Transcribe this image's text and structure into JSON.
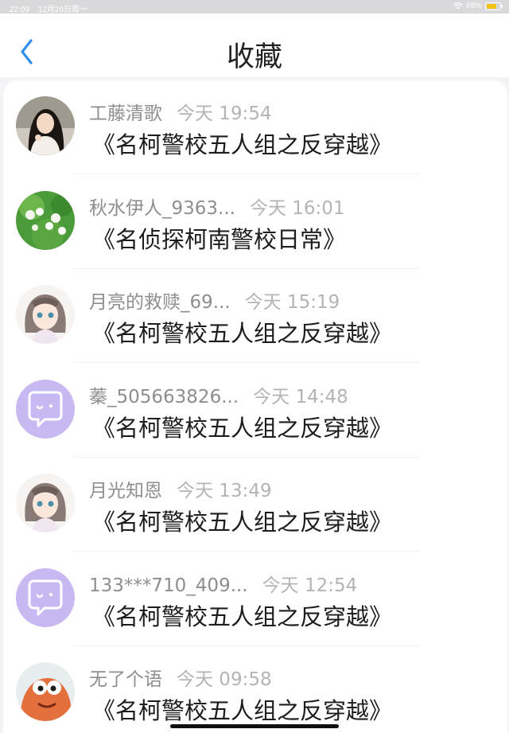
{
  "status_bar": {
    "time": "22:09",
    "date": "12月26日周一",
    "battery": "69%",
    "battery_level": 0.69
  },
  "header": {
    "title": "收藏",
    "back_icon": "chevron-left-icon"
  },
  "colors": {
    "accent": "#2f8ff0",
    "avatar_placeholder": "#c9b9f2"
  },
  "items": [
    {
      "user": "工藤清歌",
      "time": "今天 19:54",
      "title": "《名柯警校五人组之反穿越》",
      "avatar": "photo-girl-avatar"
    },
    {
      "user": "秋水伊人_9363...",
      "time": "今天 16:01",
      "title": "《名侦探柯南警校日常》",
      "avatar": "flowers-avatar"
    },
    {
      "user": "月亮的救赎_69...",
      "time": "今天 15:19",
      "title": "《名柯警校五人组之反穿越》",
      "avatar": "anime-girl-avatar"
    },
    {
      "user": "蓁_505663826...",
      "time": "今天 14:48",
      "title": "《名柯警校五人组之反穿越》",
      "avatar": "chat-bubble-avatar"
    },
    {
      "user": "月光知恩",
      "time": "今天 13:49",
      "title": "《名柯警校五人组之反穿越》",
      "avatar": "anime-girl-avatar"
    },
    {
      "user": "133***710_409...",
      "time": "今天 12:54",
      "title": "《名柯警校五人组之反穿越》",
      "avatar": "chat-bubble-avatar"
    },
    {
      "user": "无了个语",
      "time": "今天 09:58",
      "title": "《名柯警校五人组之反穿越》",
      "avatar": "patrick-star-avatar"
    }
  ]
}
